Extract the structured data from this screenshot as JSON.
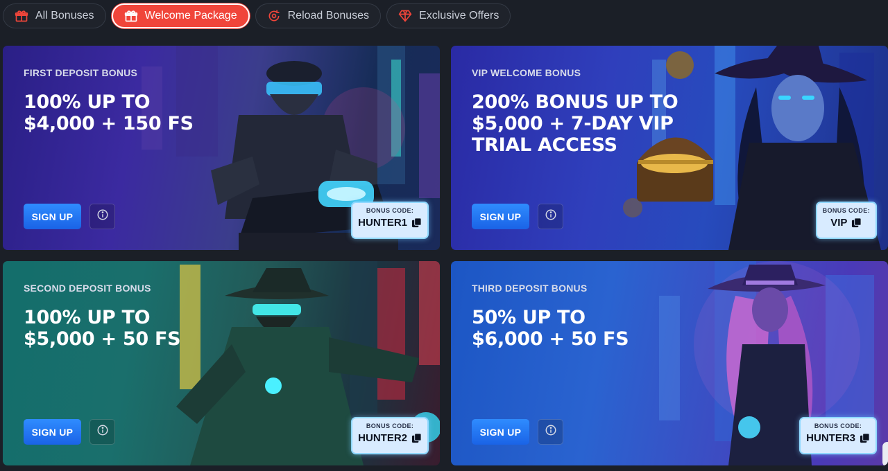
{
  "tabs": [
    {
      "label": "All Bonuses",
      "icon": "gift-icon",
      "active": false
    },
    {
      "label": "Welcome Package",
      "icon": "gift-icon",
      "active": true
    },
    {
      "label": "Reload Bonuses",
      "icon": "reload-icon",
      "active": false
    },
    {
      "label": "Exclusive Offers",
      "icon": "diamond-icon",
      "active": false
    }
  ],
  "colors": {
    "accent": "#f0453a",
    "button": "#1f6ff0",
    "code_border": "#8fd8ff"
  },
  "cards": [
    {
      "eyebrow": "FIRST DEPOSIT BONUS",
      "headline": "100% UP TO\n$4,000 + 150 FS",
      "signup": "SIGN UP",
      "code_label": "BONUS CODE:",
      "code": "HUNTER1"
    },
    {
      "eyebrow": "VIP WELCOME BONUS",
      "headline": "200% BONUS UP TO\n$5,000 + 7-DAY VIP\nTRIAL ACCESS",
      "signup": "SIGN UP",
      "code_label": "BONUS CODE:",
      "code": "VIP"
    },
    {
      "eyebrow": "SECOND DEPOSIT BONUS",
      "headline": "100% UP TO\n$5,000 + 50 FS",
      "signup": "SIGN UP",
      "code_label": "BONUS CODE:",
      "code": "HUNTER2"
    },
    {
      "eyebrow": "THIRD DEPOSIT BONUS",
      "headline": "50% UP TO\n$6,000 + 50 FS",
      "signup": "SIGN UP",
      "code_label": "BONUS CODE:",
      "code": "HUNTER3"
    }
  ]
}
